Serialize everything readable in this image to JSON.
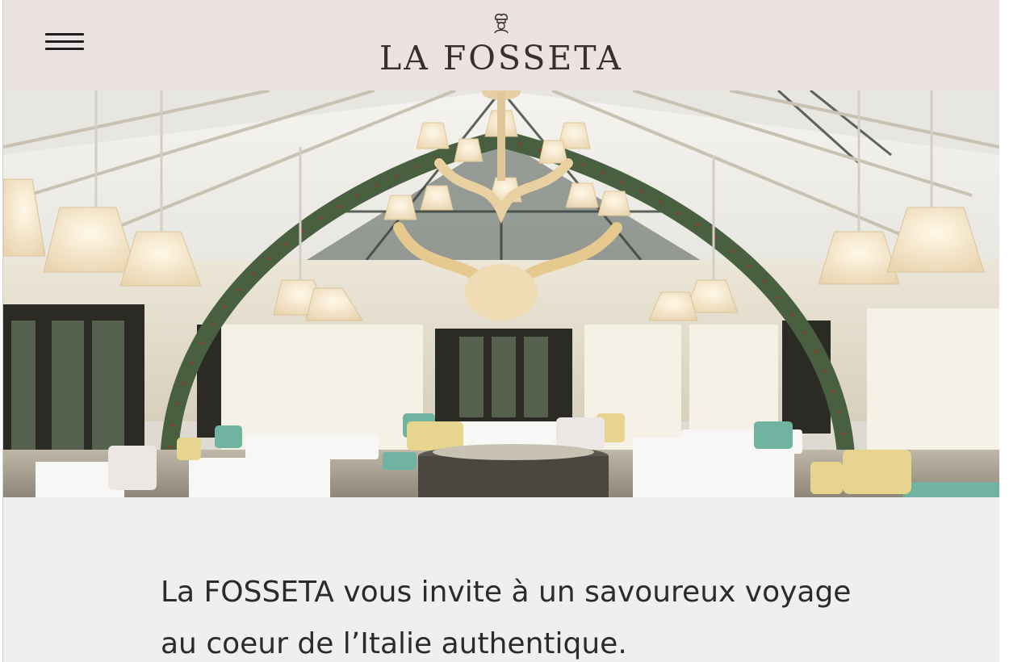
{
  "header": {
    "brand": "LA FOSSETA",
    "menu_icon": "hamburger-menu-icon",
    "logo_icon": "chef-icon",
    "background": "#ebe3e1"
  },
  "hero": {
    "image_description_icon": "restaurant-photo"
  },
  "intro": {
    "tagline": "La FOSSETA vous invite à un savoureux voyage au coeur de l’Italie authentique."
  },
  "colors": {
    "page_bg": "#efefef",
    "text": "#2b2b2b",
    "brand_text": "#3b2f2a"
  }
}
